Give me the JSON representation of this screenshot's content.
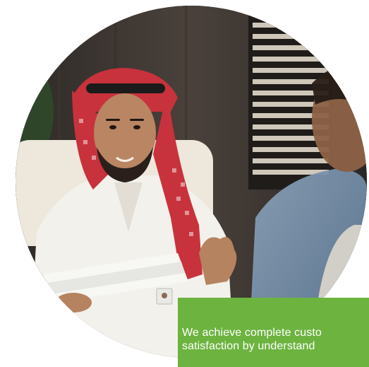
{
  "photo": {
    "alt_icon": "business-meeting-photo",
    "subject": "man in white thobe and red-checkered shemagh holding documents, seated across from another man",
    "colors": {
      "wall": "#3b3430",
      "blinds": "#c9c2b4",
      "thobe": "#f2f0ec",
      "shemagh_red": "#c8323c",
      "chair": "#ece6da",
      "skin": "#b5835f",
      "shirt_blue": "#6f8aa6"
    }
  },
  "caption": {
    "line1": "We achieve complete custo",
    "line2": "satisfaction by understand",
    "background": "#6db33f",
    "text_color": "#ffffff"
  }
}
